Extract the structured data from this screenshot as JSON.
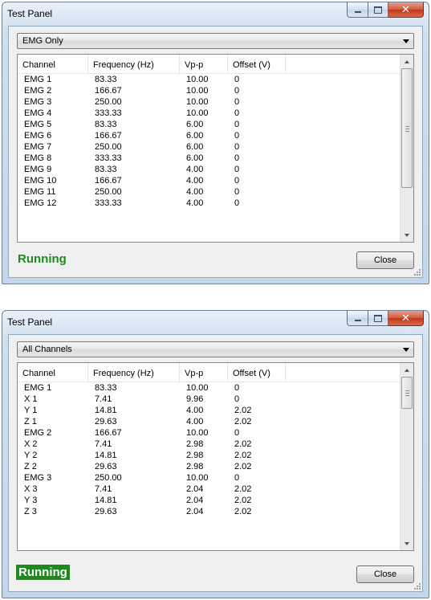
{
  "windows": [
    {
      "title": "Test Panel",
      "filter": "EMG Only",
      "columns": [
        "Channel",
        "Frequency (Hz)",
        "Vp-p",
        "Offset (V)"
      ],
      "rows": [
        [
          "EMG 1",
          "83.33",
          "10.00",
          "0"
        ],
        [
          "EMG 2",
          "166.67",
          "10.00",
          "0"
        ],
        [
          "EMG 3",
          "250.00",
          "10.00",
          "0"
        ],
        [
          "EMG 4",
          "333.33",
          "10.00",
          "0"
        ],
        [
          "EMG 5",
          "83.33",
          "6.00",
          "0"
        ],
        [
          "EMG 6",
          "166.67",
          "6.00",
          "0"
        ],
        [
          "EMG 7",
          "250.00",
          "6.00",
          "0"
        ],
        [
          "EMG 8",
          "333.33",
          "6.00",
          "0"
        ],
        [
          "EMG 9",
          "83.33",
          "4.00",
          "0"
        ],
        [
          "EMG 10",
          "166.67",
          "4.00",
          "0"
        ],
        [
          "EMG 11",
          "250.00",
          "4.00",
          "0"
        ],
        [
          "EMG 12",
          "333.33",
          "4.00",
          "0"
        ]
      ],
      "status": "Running",
      "close_label": "Close",
      "scroll": {
        "position": 0.0,
        "visible_fraction": 0.75
      }
    },
    {
      "title": "Test Panel",
      "filter": "All Channels",
      "columns": [
        "Channel",
        "Frequency (Hz)",
        "Vp-p",
        "Offset (V)"
      ],
      "rows": [
        [
          "EMG 1",
          "83.33",
          "10.00",
          "0"
        ],
        [
          "X 1",
          "7.41",
          "9.96",
          "0"
        ],
        [
          "Y 1",
          "14.81",
          "4.00",
          "2.02"
        ],
        [
          "Z 1",
          "29.63",
          "4.00",
          "2.02"
        ],
        [
          "EMG 2",
          "166.67",
          "10.00",
          "0"
        ],
        [
          "X 2",
          "7.41",
          "2.98",
          "2.02"
        ],
        [
          "Y 2",
          "14.81",
          "2.98",
          "2.02"
        ],
        [
          "Z 2",
          "29.63",
          "2.98",
          "2.02"
        ],
        [
          "EMG 3",
          "250.00",
          "10.00",
          "0"
        ],
        [
          "X 3",
          "7.41",
          "2.04",
          "2.02"
        ],
        [
          "Y 3",
          "14.81",
          "2.04",
          "2.02"
        ],
        [
          "Z 3",
          "29.63",
          "2.04",
          "2.02"
        ]
      ],
      "status": "Running",
      "close_label": "Close",
      "scroll": {
        "position": 0.0,
        "visible_fraction": 0.2
      }
    }
  ],
  "colors": {
    "status_running": "#1e8a1e",
    "close_button": "#c0371b"
  },
  "icons": [
    "minimize-icon",
    "maximize-icon",
    "close-icon",
    "chevron-down-icon",
    "scroll-up-icon",
    "scroll-down-icon",
    "resize-grip-icon"
  ]
}
